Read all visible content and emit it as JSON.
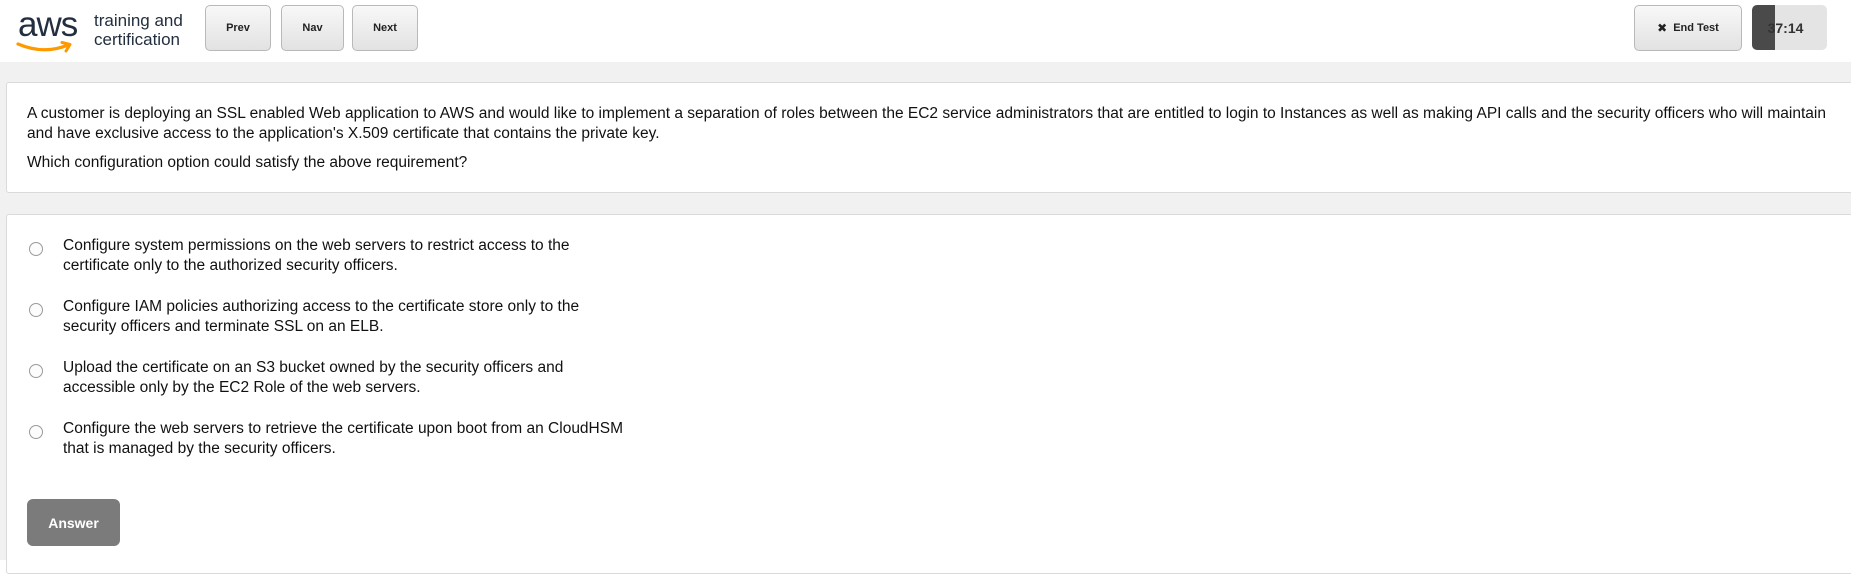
{
  "logo": {
    "brand": "aws",
    "tagline_line1": "training and",
    "tagline_line2": "certification",
    "smile_color": "#ff9900"
  },
  "toolbar": {
    "prev_label": "Prev",
    "nav_label": "Nav",
    "next_label": "Next",
    "end_test_label": "End Test",
    "end_test_icon": "close-icon"
  },
  "timer": {
    "display": "37:14",
    "elapsed_fraction": 0.31
  },
  "question": {
    "text": "A customer is deploying an SSL enabled Web application to AWS and would like to implement a separation of roles between the EC2 service administrators that are entitled to login to Instances as well as making API calls and the security officers who will maintain and have exclusive access to the application's X.509 certificate that contains the private key.",
    "prompt": "Which configuration option could satisfy the above requirement?"
  },
  "options": [
    {
      "label": "Configure system permissions on the web servers to restrict access to the certificate only to the authorized security officers.",
      "selected": false
    },
    {
      "label": "Configure IAM policies authorizing access to the certificate store only to the security officers and terminate SSL on an ELB.",
      "selected": false
    },
    {
      "label": "Upload the certificate on an S3 bucket owned by the security officers and accessible only by the EC2 Role of the web servers.",
      "selected": false
    },
    {
      "label": "Configure the web servers to retrieve the certificate upon boot from an CloudHSM that is managed by the security officers.",
      "selected": false
    }
  ],
  "answer_button": {
    "label": "Answer"
  },
  "colors": {
    "page_gray": "#f1f1f1",
    "answer_button_bg": "#7b7b7b",
    "timer_fill": "#4a4a4a"
  }
}
